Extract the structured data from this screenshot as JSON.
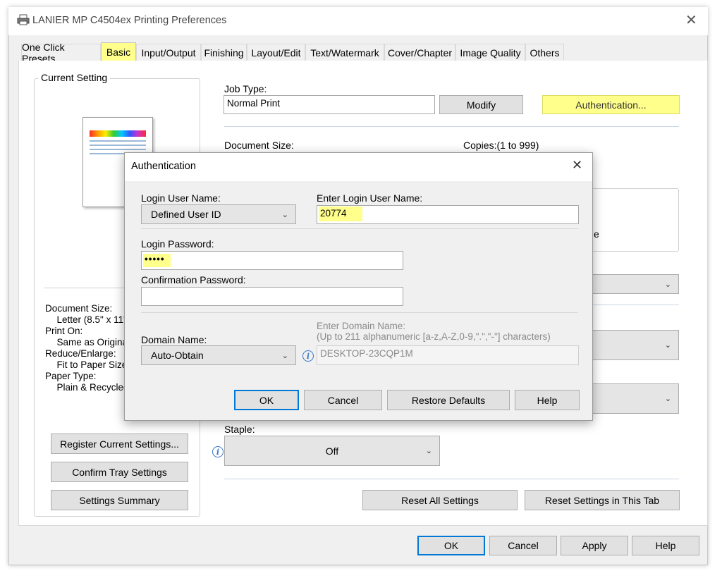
{
  "window": {
    "title": "LANIER MP C4504ex Printing Preferences"
  },
  "tabs": [
    "One Click Presets",
    "Basic",
    "Input/Output",
    "Finishing",
    "Layout/Edit",
    "Text/Watermark",
    "Cover/Chapter",
    "Image Quality",
    "Others"
  ],
  "current_setting": {
    "label": "Current Setting",
    "summary": [
      "Document Size:",
      "  Letter (8.5\" x 11\"",
      "Print On:",
      "  Same as Original",
      "Reduce/Enlarge:",
      "  Fit to Paper Size",
      "Paper Type:",
      "  Plain & Recycled"
    ],
    "buttons": {
      "register": "Register Current Settings...",
      "confirm_tray": "Confirm Tray Settings",
      "summary": "Settings Summary"
    }
  },
  "job_type": {
    "label": "Job Type:",
    "value": "Normal Print",
    "modify": "Modify",
    "authentication": "Authentication..."
  },
  "document_size": {
    "label": "Document Size:"
  },
  "copies": {
    "label": "Copies:(1 to 999)"
  },
  "background": {
    "partial_text": "e"
  },
  "staple": {
    "label": "Staple:",
    "value": "Off"
  },
  "panel_buttons": {
    "reset_all": "Reset All Settings",
    "reset_tab": "Reset Settings in This Tab"
  },
  "footer": {
    "ok": "OK",
    "cancel": "Cancel",
    "apply": "Apply",
    "help": "Help"
  },
  "dialog": {
    "title": "Authentication",
    "login_user_name_label": "Login User Name:",
    "login_user_name_value": "Defined User ID",
    "enter_login_label": "Enter Login User Name:",
    "enter_login_value": "20774",
    "login_password_label": "Login Password:",
    "login_password_value": "•••••",
    "confirm_password_label": "Confirmation Password:",
    "domain_label": "Domain Name:",
    "domain_value": "Auto-Obtain",
    "enter_domain_label": "Enter Domain Name:",
    "enter_domain_hint": "(Up to 211 alphanumeric [a-z,A-Z,0-9,\".\",\"-\"] characters)",
    "domain_name_value": "DESKTOP-23CQP1M",
    "ok": "OK",
    "cancel": "Cancel",
    "restore": "Restore Defaults",
    "help": "Help"
  }
}
